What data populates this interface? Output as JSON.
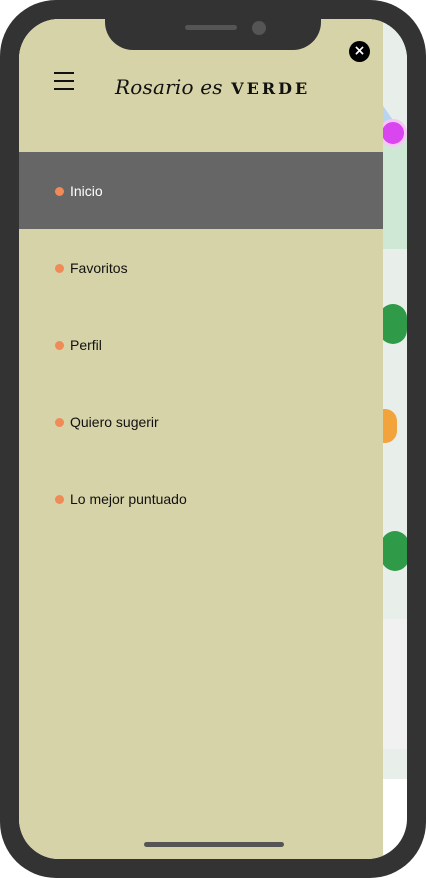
{
  "app": {
    "logo_script": "Rosario es",
    "logo_bold": "VERDE"
  },
  "header": {
    "menu_icon": "hamburger-menu-icon",
    "close_icon": "close-icon",
    "close_glyph": "×"
  },
  "menu": {
    "items": [
      {
        "label": "Inicio",
        "active": true
      },
      {
        "label": "Favoritos",
        "active": false
      },
      {
        "label": "Perfil",
        "active": false
      },
      {
        "label": "Quiero sugerir",
        "active": false
      },
      {
        "label": "Lo mejor puntuado",
        "active": false
      }
    ]
  },
  "colors": {
    "drawer_bg": "#d6d3a8",
    "active_item_bg": "#666666",
    "bullet": "#f08a57",
    "device_frame": "#333333"
  }
}
